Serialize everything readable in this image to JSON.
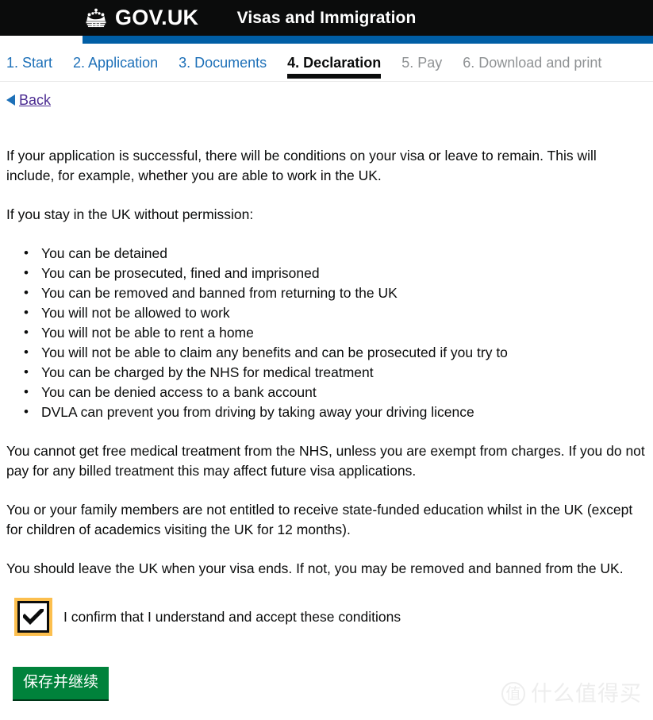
{
  "header": {
    "brand_name": "GOV.UK",
    "crown_icon": "crown-icon",
    "service_name": "Visas and Immigration",
    "bar_color": "#005ea5",
    "background_color": "#0b0c0c"
  },
  "tabs": [
    {
      "label": "1. Start",
      "state": "link"
    },
    {
      "label": "2. Application",
      "state": "link"
    },
    {
      "label": "3. Documents",
      "state": "link"
    },
    {
      "label": "4. Declaration",
      "state": "current"
    },
    {
      "label": "5. Pay",
      "state": "disabled"
    },
    {
      "label": "6. Download and print",
      "state": "disabled"
    }
  ],
  "back": {
    "label": "Back",
    "icon": "back-arrow-icon",
    "arrow_color": "#1d70b8",
    "text_color": "#4c2c92"
  },
  "main": {
    "paragraph_1": "If your application is successful, there will be conditions on your visa or leave to remain. This will include, for example, whether you are able to work in the UK.",
    "paragraph_2": "If you stay in the UK without permission:",
    "conditions": [
      "You can be detained",
      "You can be prosecuted, fined and imprisoned",
      "You can be removed and banned from returning to the UK",
      "You will not be allowed to work",
      "You will not be able to rent a home",
      "You will not be able to claim any benefits and can be prosecuted if you try to",
      "You can be charged by the NHS for medical treatment",
      "You can be denied access to a bank account",
      "DVLA can prevent you from driving by taking away your driving licence"
    ],
    "paragraph_3": "You cannot get free medical treatment from the NHS, unless you are exempt from charges. If you do not pay for any billed treatment this may affect future visa applications.",
    "paragraph_4": "You or your family members are not entitled to receive state-funded education whilst in the UK (except for children of academics visiting the UK for 12 months).",
    "paragraph_5": "You should leave the UK when your visa ends. If not, you may be removed and banned from the UK."
  },
  "declaration": {
    "checkbox_label": "I confirm that I understand and accept these conditions",
    "checked": true,
    "focus_color": "#fcbf4e",
    "check_icon": "checkmark-icon"
  },
  "actions": {
    "save_label": "保存并继续",
    "save_color": "#00823b"
  },
  "watermark": {
    "badge": "值",
    "text": "什么值得买"
  }
}
